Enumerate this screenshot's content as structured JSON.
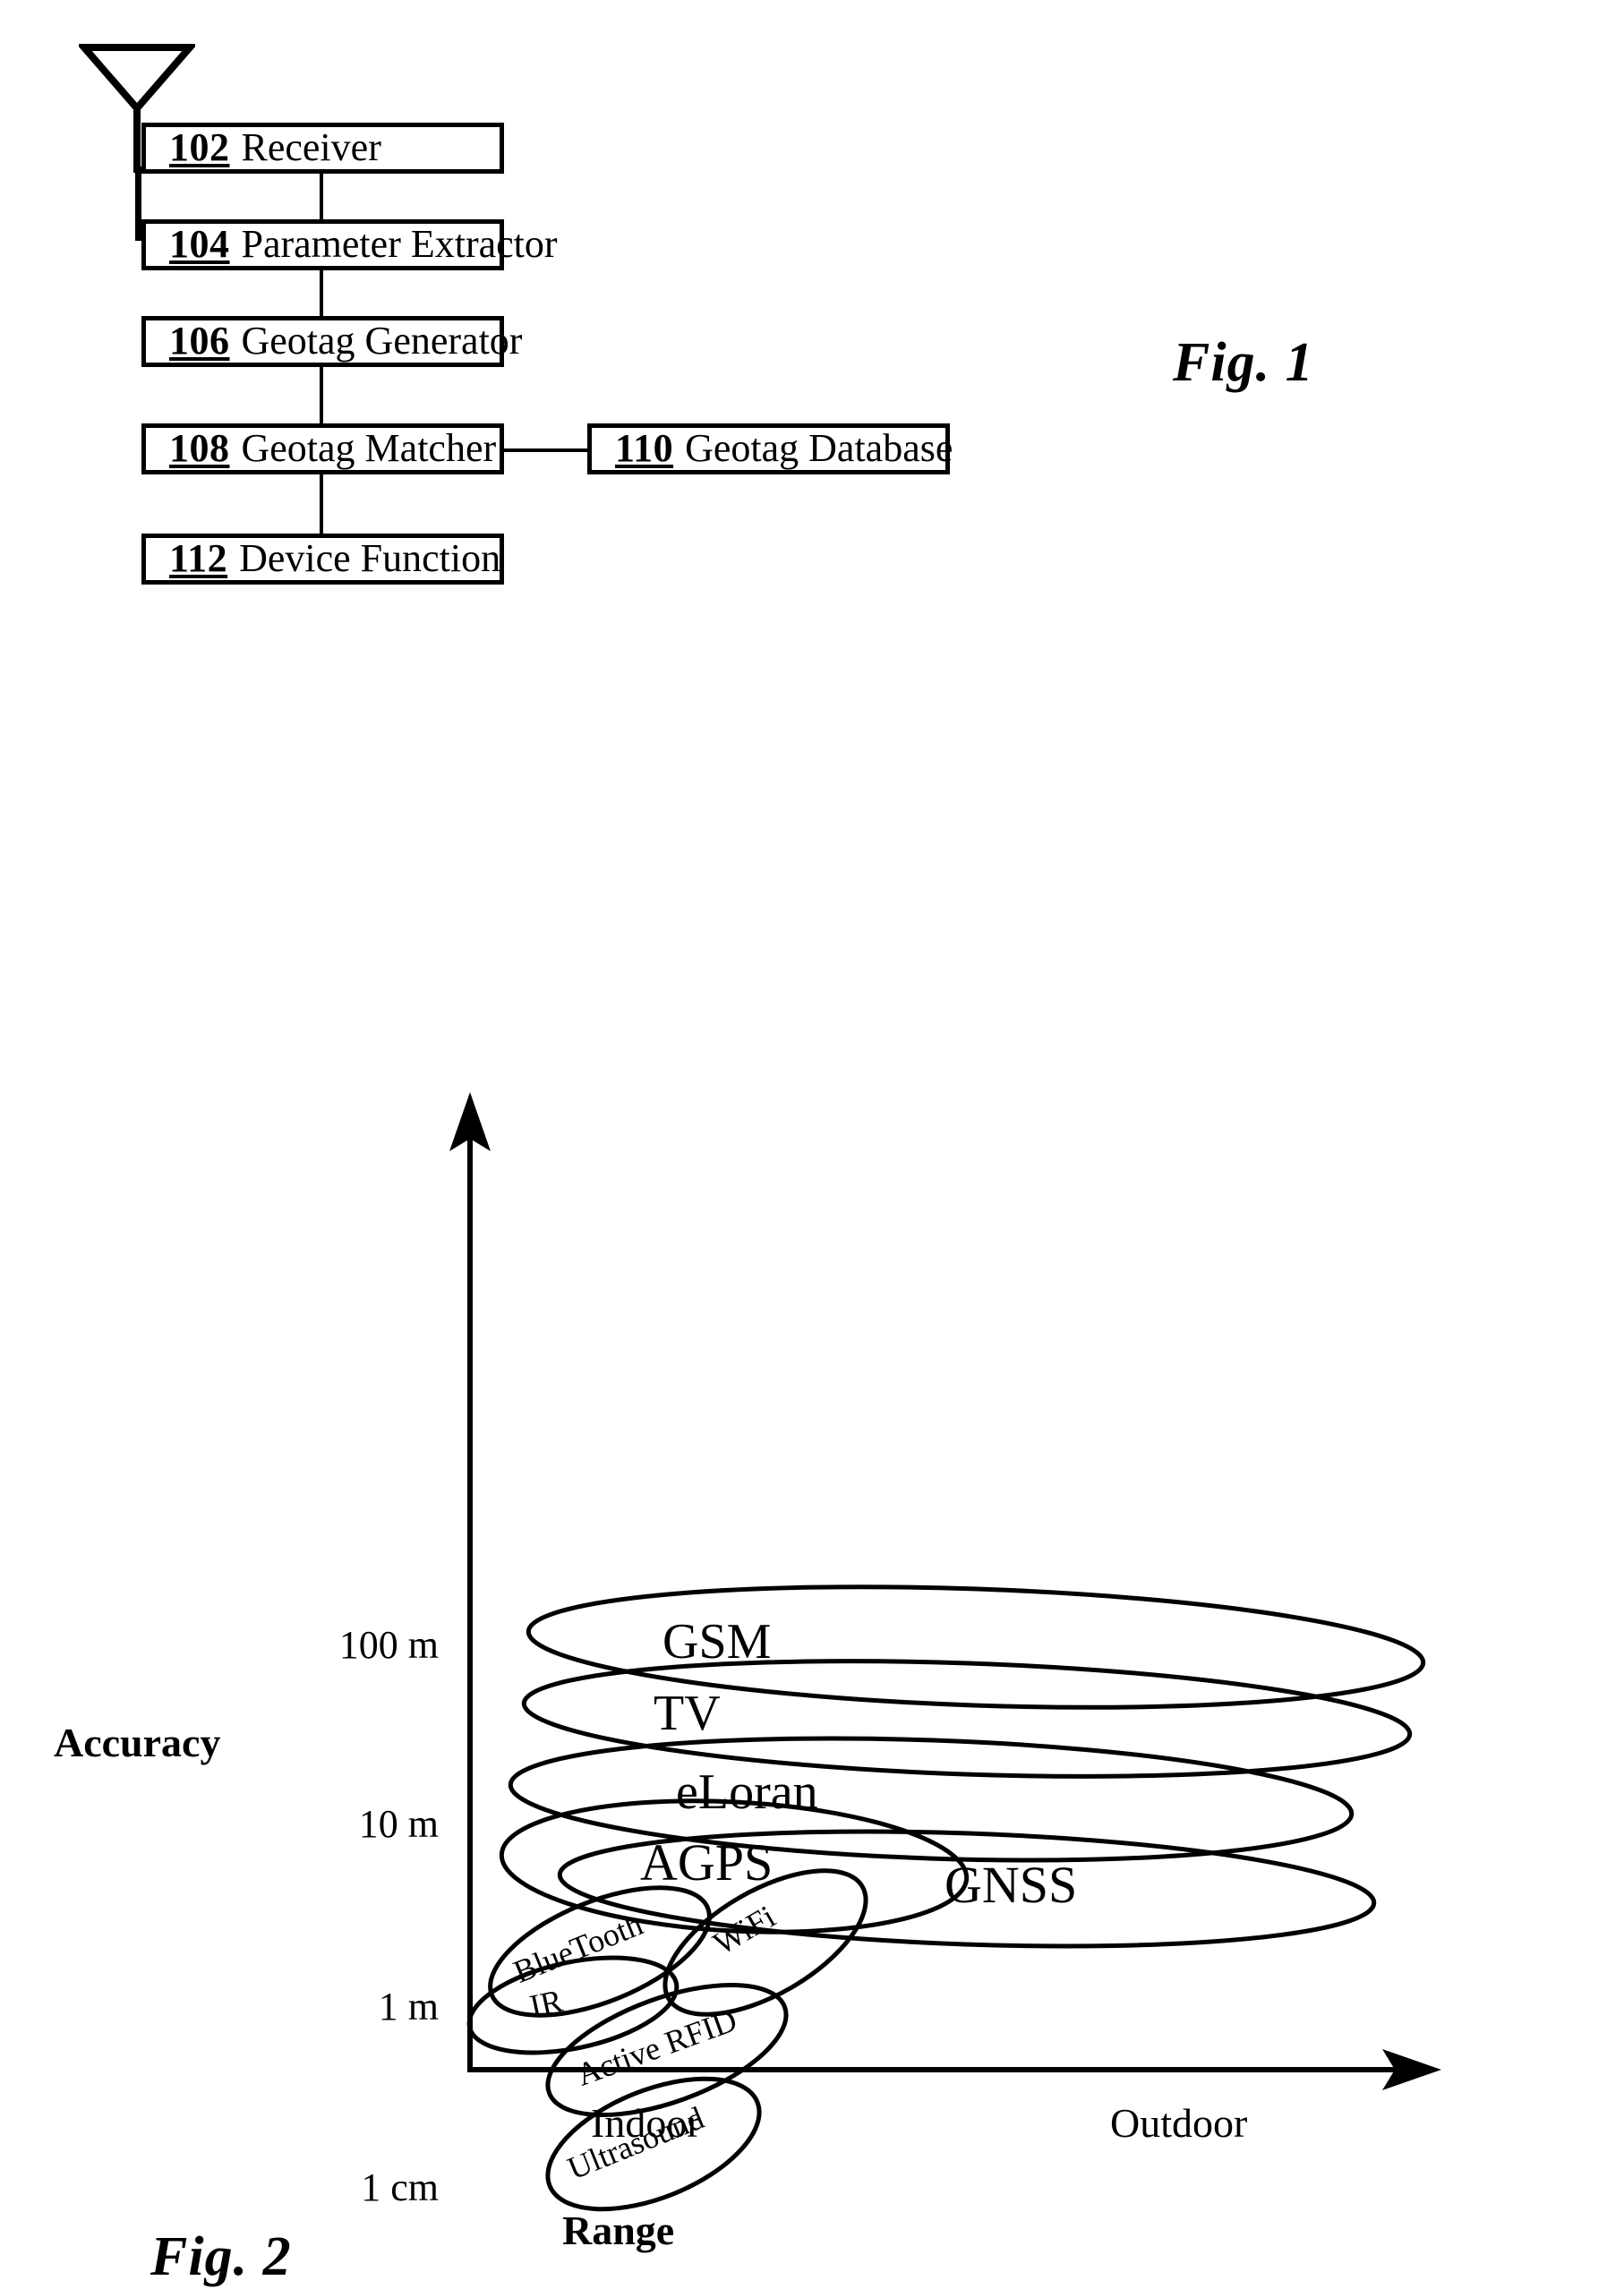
{
  "figure1": {
    "caption": "Fig. 1",
    "antenna_icon": "antenna-icon",
    "blocks": [
      {
        "num": "102",
        "label": "Receiver"
      },
      {
        "num": "104",
        "label": "Parameter Extractor"
      },
      {
        "num": "106",
        "label": "Geotag Generator"
      },
      {
        "num": "108",
        "label": "Geotag Matcher"
      },
      {
        "num": "110",
        "label": "Geotag Database"
      },
      {
        "num": "112",
        "label": "Device Function"
      }
    ]
  },
  "figure2": {
    "caption": "Fig. 2",
    "chart_data": {
      "type": "scatter",
      "title": "Fig. 2",
      "xlabel": "Range",
      "ylabel": "Accuracy",
      "x_tick_labels": [
        "Indoor",
        "Outdoor"
      ],
      "y_tick_labels": [
        "100 m",
        "10 m",
        "1 m",
        "1 cm"
      ],
      "grid": false,
      "legend": "none",
      "axis_arrows": [
        "up",
        "right"
      ],
      "series": [
        {
          "name": "GSM",
          "range": "outdoor-wide",
          "accuracy": "100 m"
        },
        {
          "name": "TV",
          "range": "outdoor-wide",
          "accuracy": "100 m"
        },
        {
          "name": "eLoran",
          "range": "outdoor-wide",
          "accuracy": "30 m"
        },
        {
          "name": "AGPS",
          "range": "mid",
          "accuracy": "10 m"
        },
        {
          "name": "GNSS",
          "range": "outdoor",
          "accuracy": "10 m"
        },
        {
          "name": "BlueTooth",
          "range": "indoor",
          "accuracy": "2 m"
        },
        {
          "name": "WiFi",
          "range": "indoor",
          "accuracy": "3 m"
        },
        {
          "name": "IR",
          "range": "indoor",
          "accuracy": "1 m"
        },
        {
          "name": "Active RFID",
          "range": "indoor",
          "accuracy": "0.5 m"
        },
        {
          "name": "Ultrasound",
          "range": "indoor",
          "accuracy": "1 cm"
        }
      ]
    },
    "y_ticks": [
      {
        "label": "100 m"
      },
      {
        "label": "10 m"
      },
      {
        "label": "1 m"
      },
      {
        "label": "1 cm"
      }
    ],
    "x_categories": [
      {
        "label": "Indoor"
      },
      {
        "label": "Outdoor"
      }
    ],
    "axis_titles": {
      "y": "Accuracy",
      "x": "Range"
    },
    "bubbles": [
      {
        "name": "GSM"
      },
      {
        "name": "TV"
      },
      {
        "name": "eLoran"
      },
      {
        "name": "AGPS"
      },
      {
        "name": "GNSS"
      },
      {
        "name": "BlueTooth"
      },
      {
        "name": "WiFi"
      },
      {
        "name": "IR"
      },
      {
        "name": "Active RFID"
      },
      {
        "name": "Ultrasound"
      }
    ]
  }
}
